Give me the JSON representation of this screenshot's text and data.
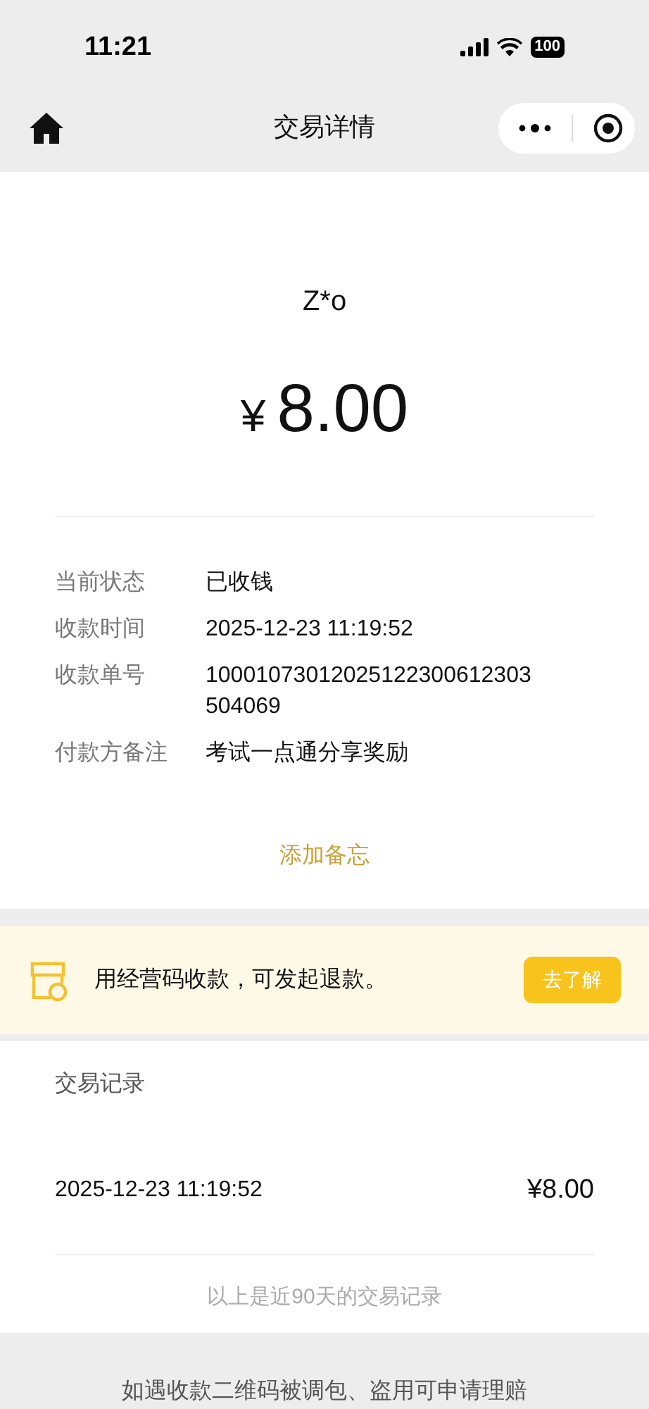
{
  "status_bar": {
    "time": "11:21",
    "battery": "100"
  },
  "nav": {
    "title": "交易详情"
  },
  "payer": {
    "name": "Z*o",
    "currency": "¥",
    "amount": "8.00"
  },
  "details": [
    {
      "label": "当前状态",
      "value": "已收钱"
    },
    {
      "label": "收款时间",
      "value": "2025-12-23 11:19:52"
    },
    {
      "label": "收款单号",
      "value": "10001073012025122300612303504069"
    },
    {
      "label": "付款方备注",
      "value": "考试一点通分享奖励"
    }
  ],
  "add_memo": "添加备忘",
  "banner": {
    "text": "用经营码收款，可发起退款。",
    "button": "去了解"
  },
  "records": {
    "title": "交易记录",
    "rows": [
      {
        "time": "2025-12-23 11:19:52",
        "amount": "¥8.00"
      }
    ],
    "note": "以上是近90天的交易记录"
  },
  "footer": "如遇收款二维码被调包、盗用可申请理赔"
}
